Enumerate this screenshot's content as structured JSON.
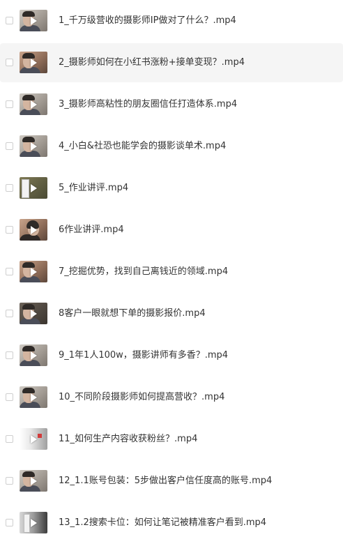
{
  "files": [
    {
      "name": "1_千万级营收的摄影师IP做对了什么？.mp4"
    },
    {
      "name": "2_摄影师如何在小红书涨粉+接单变现？.mp4"
    },
    {
      "name": "3_摄影师高粘性的朋友圈信任打造体系.mp4"
    },
    {
      "name": "4_小白&社恐也能学会的摄影谈单术.mp4"
    },
    {
      "name": "5_作业讲评.mp4"
    },
    {
      "name": "6作业讲评.mp4"
    },
    {
      "name": "7_挖掘优势，找到自己离钱近的领域.mp4"
    },
    {
      "name": "8客户一眼就想下单的摄影报价.mp4"
    },
    {
      "name": "9_1年1人100w，摄影讲师有多香？.mp4"
    },
    {
      "name": "10_不同阶段摄影师如何提高营收？.mp4"
    },
    {
      "name": "11_如何生产内容收获粉丝？.mp4"
    },
    {
      "name": "12_1.1账号包装：5步做出客户信任度高的账号.mp4"
    },
    {
      "name": "13_1.2搜索卡位：如何让笔记被精准客户看到.mp4"
    }
  ]
}
